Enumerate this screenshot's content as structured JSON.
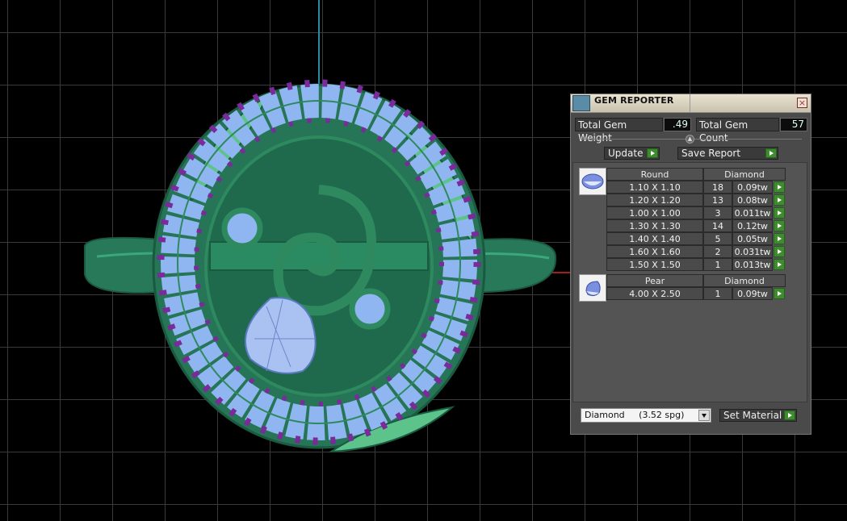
{
  "panel": {
    "title": "GEM REPORTER",
    "close_label": "×",
    "total_weight_label": "Total Gem Weight",
    "total_weight_value": ".49",
    "total_count_label": "Total Gem Count",
    "total_count_value": "57",
    "update_label": "Update",
    "save_report_label": "Save Report",
    "groups": [
      {
        "shape": "Round",
        "material": "Diamond",
        "rows": [
          {
            "size": "1.10 X 1.10",
            "count": "18",
            "weight": "0.09tw"
          },
          {
            "size": "1.20 X 1.20",
            "count": "13",
            "weight": "0.08tw"
          },
          {
            "size": "1.00 X 1.00",
            "count": "3",
            "weight": "0.011tw"
          },
          {
            "size": "1.30 X 1.30",
            "count": "14",
            "weight": "0.12tw"
          },
          {
            "size": "1.40 X 1.40",
            "count": "5",
            "weight": "0.05tw"
          },
          {
            "size": "1.60 X 1.60",
            "count": "2",
            "weight": "0.031tw"
          },
          {
            "size": "1.50 X 1.50",
            "count": "1",
            "weight": "0.013tw"
          }
        ]
      },
      {
        "shape": "Pear",
        "material": "Diamond",
        "rows": [
          {
            "size": "4.00 X 2.50",
            "count": "1",
            "weight": "0.09tw"
          }
        ]
      }
    ],
    "material_select": "Diamond     (3.52 spg)",
    "set_material_label": "Set Material"
  },
  "colors": {
    "metal": "#2e8a5e",
    "gem": "#8fb6f0",
    "prong": "#7a2a9a",
    "grid": "#3a3a3a",
    "action_green": "#3d8c2e"
  }
}
